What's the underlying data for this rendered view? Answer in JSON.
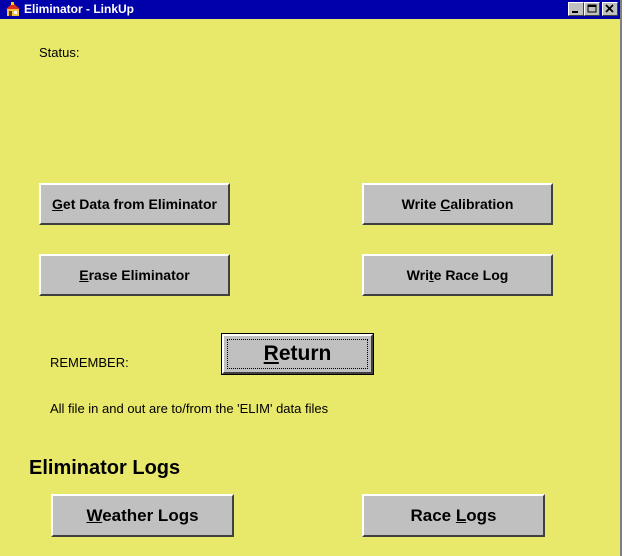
{
  "window": {
    "title": "Eliminator - LinkUp",
    "icon": "app-house-icon",
    "controls": [
      "minimize",
      "maximize",
      "close"
    ]
  },
  "status": {
    "label": "Status:"
  },
  "buttons": {
    "get_data": {
      "before": "",
      "mnemonic": "G",
      "after": "et Data from Eliminator"
    },
    "write_calibration": {
      "before": "Write ",
      "mnemonic": "C",
      "after": "alibration"
    },
    "erase": {
      "before": "",
      "mnemonic": "E",
      "after": "rase Eliminator"
    },
    "write_race_log": {
      "before": "Wri",
      "mnemonic": "t",
      "after": "e Race Log"
    },
    "return": {
      "before": "",
      "mnemonic": "R",
      "after": "eturn"
    },
    "weather_logs": {
      "before": "",
      "mnemonic": "W",
      "after": "eather Logs"
    },
    "race_logs": {
      "before": "Race ",
      "mnemonic": "L",
      "after": "ogs"
    }
  },
  "notes": {
    "remember": "REMEMBER:",
    "files": "All file in and out are to/from the 'ELIM' data files"
  },
  "logs": {
    "heading": "Eliminator Logs"
  },
  "colors": {
    "background": "#e8e86a",
    "titlebar": "#0000aa",
    "button_face": "#c0c0c0"
  }
}
